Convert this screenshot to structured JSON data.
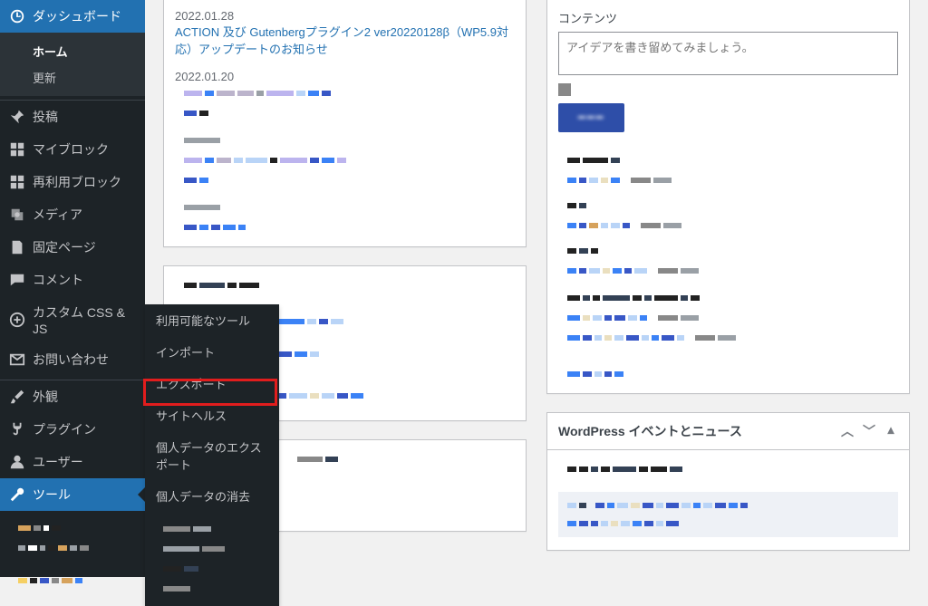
{
  "sidebar": {
    "dashboard": {
      "label": "ダッシュボード",
      "sub_home": "ホーム",
      "sub_update": "更新"
    },
    "items": [
      {
        "label": "投稿"
      },
      {
        "label": "マイブロック"
      },
      {
        "label": "再利用ブロック"
      },
      {
        "label": "メディア"
      },
      {
        "label": "固定ページ"
      },
      {
        "label": "コメント"
      },
      {
        "label": "カスタム CSS & JS"
      },
      {
        "label": "お問い合わせ"
      }
    ],
    "items2": [
      {
        "label": "外観"
      },
      {
        "label": "プラグイン"
      },
      {
        "label": "ユーザー"
      },
      {
        "label": "ツール"
      }
    ]
  },
  "flyout": {
    "items": [
      "利用可能なツール",
      "インポート",
      "エクスポート",
      "サイトヘルス",
      "個人データのエクスポート",
      "個人データの消去"
    ]
  },
  "news": {
    "date1": "2022.01.28",
    "link1": "ACTION 及び Gutenbergプラグイン2 ver20220128β（WP5.9対応）アップデートのお知らせ",
    "date2": "2022.01.20"
  },
  "quickdraft": {
    "legend": "コンテンツ",
    "placeholder": "アイデアを書き留めてみましょう。"
  },
  "events_panel": {
    "title": "WordPress イベントとニュース"
  }
}
